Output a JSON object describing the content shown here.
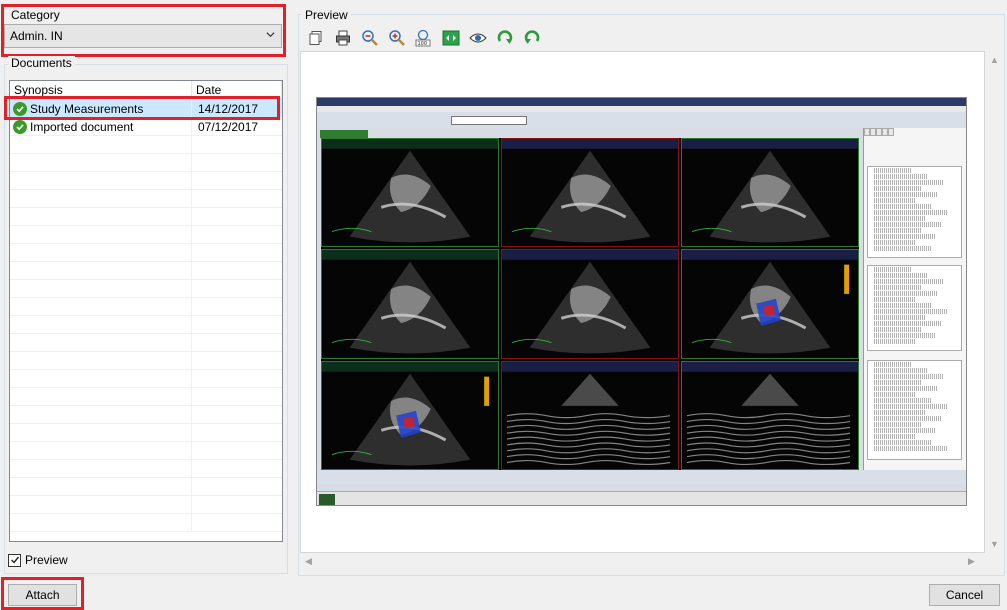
{
  "category": {
    "title": "Category",
    "selected": "Admin. IN"
  },
  "documents": {
    "title": "Documents",
    "columns": [
      "Synopsis",
      "Date"
    ],
    "rows": [
      {
        "synopsis": "Study Measurements",
        "date": "14/12/2017"
      },
      {
        "synopsis": "Imported document",
        "date": "07/12/2017"
      }
    ]
  },
  "preview_checkbox": {
    "label": "Preview",
    "checked": true
  },
  "preview": {
    "title": "Preview",
    "toolbar": [
      "copy-icon",
      "print-icon",
      "zoom-out-icon",
      "zoom-in-icon",
      "zoom-100-icon",
      "fit-icon",
      "eye-icon",
      "rotate-right-icon",
      "rotate-left-icon"
    ]
  },
  "buttons": {
    "attach": "Attach",
    "cancel": "Cancel"
  },
  "colors": {
    "highlight": "#e0212a",
    "selected_row": "#cce8ff",
    "check_green": "#3a9a2a"
  }
}
